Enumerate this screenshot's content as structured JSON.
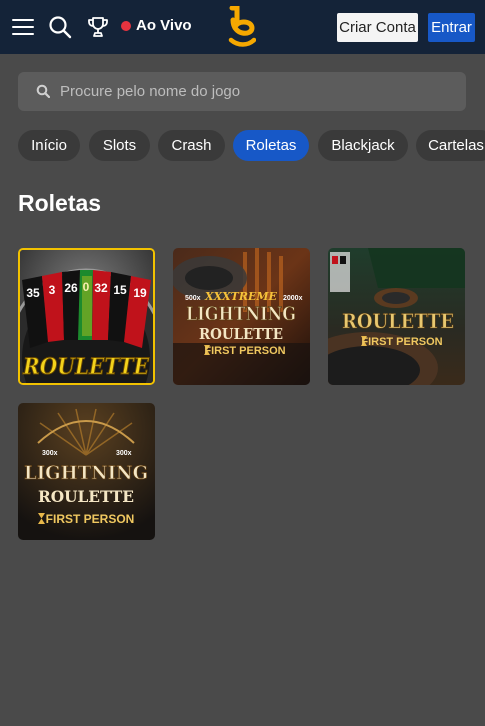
{
  "header": {
    "live_label": "Ao Vivo",
    "signup_label": "Criar Conta",
    "login_label": "Entrar",
    "live_color": "#e5333f",
    "brand_color": "#f6a800"
  },
  "search": {
    "placeholder": "Procure pelo nome do jogo"
  },
  "categories": [
    {
      "label": "Início",
      "active": false
    },
    {
      "label": "Slots",
      "active": false
    },
    {
      "label": "Crash",
      "active": false
    },
    {
      "label": "Roletas",
      "active": true
    },
    {
      "label": "Blackjack",
      "active": false
    },
    {
      "label": "Cartelas",
      "active": false
    }
  ],
  "section": {
    "title": "Roletas"
  },
  "games": [
    {
      "title_text": "ROULETTE",
      "wheel_numbers": [
        "35",
        "3",
        "26",
        "0",
        "32",
        "15",
        "19"
      ]
    },
    {
      "badge_left": "500x",
      "badge_mid": "XXXTREME",
      "badge_right": "2000x",
      "line1": "LIGHTNING",
      "line2": "ROULETTE",
      "sub": "FIRST PERSON"
    },
    {
      "line1": "ROULETTE",
      "sub": "FIRST PERSON"
    },
    {
      "badge_left": "300x",
      "badge_right": "300x",
      "line1": "LIGHTNING",
      "line2": "ROULETTE",
      "sub": "FIRST PERSON"
    }
  ],
  "icons": [
    "menu-icon",
    "search-icon",
    "trophy-icon",
    "brand-logo",
    "first-person-logo-icon"
  ]
}
